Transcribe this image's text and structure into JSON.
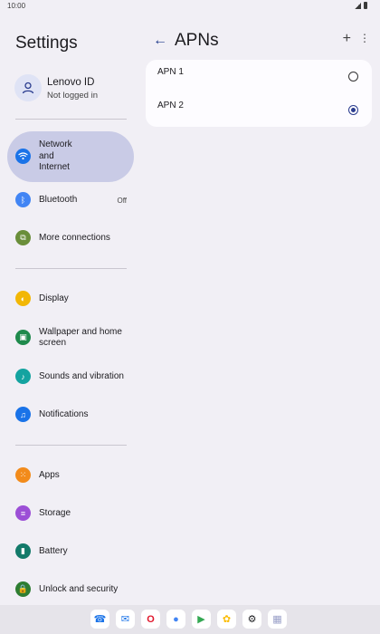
{
  "status_bar": {
    "time": "10:00"
  },
  "settings": {
    "title": "Settings",
    "account": {
      "name": "Lenovo ID",
      "status": "Not logged in"
    },
    "items": [
      {
        "label": "Network and Internet",
        "icon": "wifi-icon",
        "color": "#1a73e8",
        "active": true
      },
      {
        "label": "Bluetooth",
        "icon": "bluetooth-icon",
        "color": "#4285f4",
        "value": "Off"
      },
      {
        "label": "More connections",
        "icon": "connections-icon",
        "color": "#6a8e3a"
      },
      {
        "label": "Display",
        "icon": "display-icon",
        "color": "#f2b705"
      },
      {
        "label": "Wallpaper and home screen",
        "icon": "wallpaper-icon",
        "color": "#1f8a4c"
      },
      {
        "label": "Sounds and vibration",
        "icon": "sound-icon",
        "color": "#14a3a0"
      },
      {
        "label": "Notifications",
        "icon": "bell-icon",
        "color": "#1a73e8"
      },
      {
        "label": "Apps",
        "icon": "apps-icon",
        "color": "#f28b1b"
      },
      {
        "label": "Storage",
        "icon": "storage-icon",
        "color": "#9c4fd6"
      },
      {
        "label": "Battery",
        "icon": "battery-icon",
        "color": "#137a6a"
      },
      {
        "label": "Unlock and security",
        "icon": "lock-icon",
        "color": "#2e7d32"
      }
    ]
  },
  "apns": {
    "title": "APNs",
    "items": [
      {
        "name": "APN 1",
        "selected": false
      },
      {
        "name": "APN 2",
        "selected": true
      }
    ]
  },
  "dock": {
    "apps": [
      {
        "name": "phone-icon",
        "glyph": "☎",
        "color": "#1a73e8"
      },
      {
        "name": "messages-icon",
        "glyph": "✉",
        "color": "#1a73e8"
      },
      {
        "name": "opera-icon",
        "glyph": "O",
        "color": "#e0162b"
      },
      {
        "name": "assistant-icon",
        "glyph": "●",
        "color": "#4285f4"
      },
      {
        "name": "play-store-icon",
        "glyph": "▶",
        "color": "#34a853"
      },
      {
        "name": "photos-icon",
        "glyph": "✿",
        "color": "#fbbc05"
      },
      {
        "name": "settings-gear-icon",
        "glyph": "⚙",
        "color": "#202124"
      },
      {
        "name": "app-drawer-icon",
        "glyph": "▦",
        "color": "#9aa0c8"
      }
    ]
  }
}
